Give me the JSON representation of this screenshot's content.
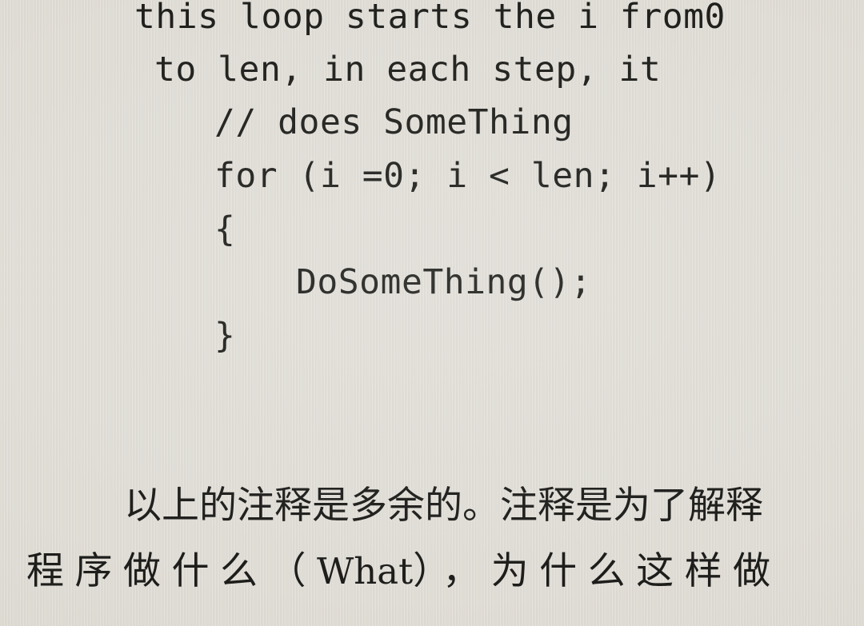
{
  "page": {
    "background_color": "#dcd9d1",
    "text_color": "#1d1d1b"
  },
  "code_block": {
    "language_style": "monospace",
    "lines": [
      {
        "id": "line-1",
        "text": "this loop starts the i from0",
        "indent_level": 0
      },
      {
        "id": "line-2",
        "text": "to len, in each step, it",
        "indent_level": 0
      },
      {
        "id": "line-3",
        "text": "// does SomeThing",
        "indent_level": 1
      },
      {
        "id": "line-4",
        "text": "for (i =0; i < len; i++)",
        "indent_level": 1
      },
      {
        "id": "line-5",
        "text": "{",
        "indent_level": 1
      },
      {
        "id": "line-6",
        "text": "DoSomeThing();",
        "indent_level": 2
      },
      {
        "id": "line-7",
        "text": "}",
        "indent_level": 1
      }
    ]
  },
  "prose_block": {
    "line_1": "以上的注释是多余的。注释是为了解释",
    "line_2_part_1": "程序做什么（",
    "line_2_latin": "What",
    "line_2_part_2": "），为什么这样做"
  }
}
